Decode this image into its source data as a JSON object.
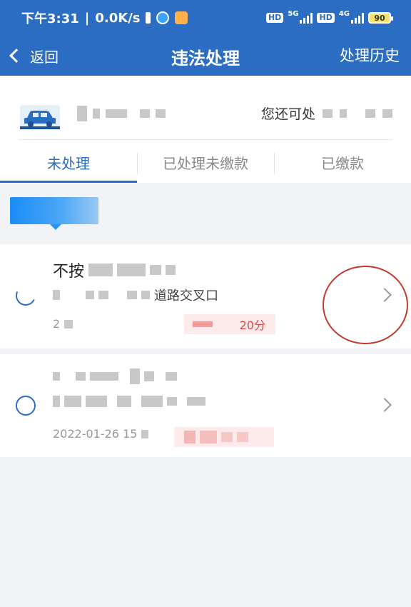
{
  "status_bar": {
    "time": "下午3:31",
    "speed": "0.0K/s",
    "hd1": "HD",
    "net1": "5G",
    "hd2": "HD",
    "net2": "4G",
    "battery": "90"
  },
  "nav": {
    "back_label": "返回",
    "title": "违法处理",
    "history_label": "处理历史"
  },
  "vehicle": {
    "remaining_prefix": "您还可处"
  },
  "tabs": [
    {
      "label": "未处理",
      "active": true
    },
    {
      "label": "已处理未缴款",
      "active": false
    },
    {
      "label": "已缴款",
      "active": false
    }
  ],
  "violations": [
    {
      "title_visible": "不按",
      "location_prefix": "",
      "location_suffix": "道路交叉口",
      "date_visible": "2",
      "points_visible": "20分"
    },
    {
      "title_visible": "",
      "location_prefix": "",
      "location_suffix": "",
      "date_visible": "2022-01-26 15",
      "points_visible": ""
    }
  ],
  "colors": {
    "primary": "#2b6dc2",
    "danger": "#e04848",
    "background": "#f2f3f7"
  }
}
